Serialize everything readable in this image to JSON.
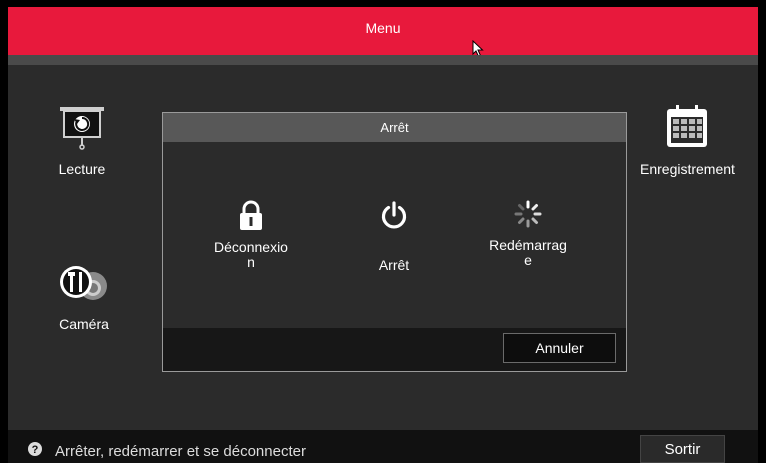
{
  "header": {
    "title": "Menu"
  },
  "menu": {
    "tiles": [
      {
        "label": "Lecture",
        "icon": "playback-icon"
      },
      {
        "label": "Enregistrement",
        "icon": "calendar-icon"
      },
      {
        "label": "Caméra",
        "icon": "camera-settings-icon"
      }
    ]
  },
  "dialog": {
    "title": "Arrêt",
    "options": [
      {
        "label": "Déconnexio\nn",
        "icon": "lock-icon"
      },
      {
        "label": "Arrêt",
        "icon": "power-icon"
      },
      {
        "label": "Redémarrag\ne",
        "icon": "spinner-icon"
      }
    ],
    "cancel_label": "Annuler"
  },
  "footer": {
    "help_text": "Arrêter, redémarrer et se déconnecter",
    "exit_label": "Sortir"
  },
  "colors": {
    "accent": "#e8193c",
    "panel": "#2b2b2b",
    "dialog_title": "#585858"
  }
}
